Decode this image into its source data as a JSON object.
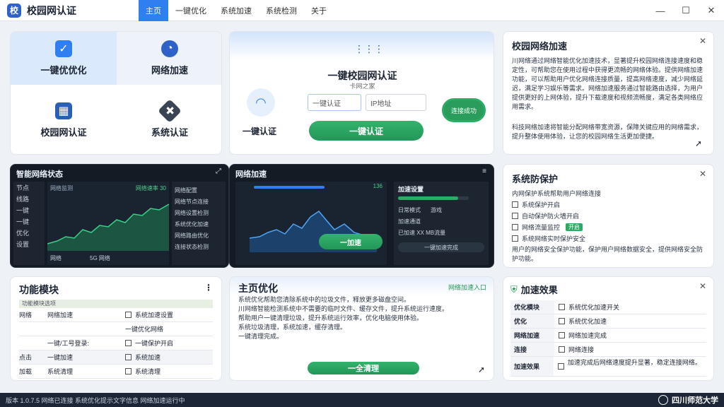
{
  "app": {
    "title": "校园网认证",
    "logo": "校"
  },
  "tabs": [
    "主页",
    "一键优化",
    "系统加速",
    "系统检测",
    "关于"
  ],
  "window": {
    "min": "—",
    "max": "☐",
    "close": "✕"
  },
  "quick": {
    "optimize": "一键优优化",
    "speed": "网络加速",
    "campus": "校园网认证",
    "sys_auth": "系统认证"
  },
  "auth": {
    "title": "一键校园网认证",
    "subtitle": "卡网之家",
    "wifi_label": "一键认证",
    "account_placeholder": "一键认证",
    "ip_placeholder": "IP地址",
    "button": "一键认证",
    "badge": "连接成功"
  },
  "accel_card": {
    "title": "校园网络加速",
    "text": "川网络通过网络智能优化加速技术，显著提升校园网络连接速度和稳定性，可帮助您在使用过程中获得更流畅的网络体验。提供网络加速功能，可以帮助用户优化网络连接质量，提高网络速度，减少网络延迟，满足学习娱乐等需求。网络加速服务通过智能路由选择，为用户提供更好的上网体验，提升下载速度和视频流畅度，满足各类网络应用需求。",
    "text2": "科技网络加速将智能分配网络带宽资源，保障关键应用的网络需求，提升整体使用体验，让您的校园网络生活更加便捷。"
  },
  "smart": {
    "title": "智能网络状态",
    "side": [
      "节点",
      "线路",
      "一键",
      "一键",
      "优化",
      "设置"
    ],
    "legend": "网络监测",
    "metric": "网络速率 30",
    "footer_left": "网络",
    "footer_mid": "5G 网络",
    "list": [
      "网络配置",
      "网络节点连接",
      "网络设置检测",
      "系统优化加速",
      "网络路由优化",
      "连接状态检测"
    ]
  },
  "speed": {
    "title": "网络加速",
    "speed_value": "136",
    "panel_title": "加速设置",
    "opt1": "日常模式",
    "opt1b": "游戏",
    "opt2": "加速通道",
    "opt3": "已加速 XX MB流量",
    "footer": "一键加速完成",
    "button": "一加速"
  },
  "protect": {
    "title": "系统防保护",
    "intro": "内网保护系统帮助用户网络连接",
    "items": [
      "系统保护开启",
      "自动保护防火墙开启",
      "网络流量监控",
      "系统网络实时保护安全"
    ],
    "badge": "开启",
    "note": "用户的网络安全保护功能，保护用户网络数据安全，提供网络安全防护功能。"
  },
  "module": {
    "title": "功能模块",
    "header": "功能模块选项",
    "rows": [
      {
        "k": "网络",
        "v": "网络加速",
        "opt": "系统加速设置"
      },
      {
        "k": "",
        "v": "",
        "opt": "一键优化网络"
      },
      {
        "k": "",
        "v": "一键/工号登录:",
        "opt": "一键保护开启"
      },
      {
        "k": "点击",
        "v": "一键加速",
        "opt": "系统加速"
      },
      {
        "k": "加载",
        "v": "系统清理",
        "opt": "系统清理"
      }
    ]
  },
  "clean": {
    "title": "主页优化",
    "tag": "网络加速入口",
    "lines": [
      "系统优化帮助您清除系统中的垃圾文件，释放更多磁盘空间。",
      "川网络智能检测系统中不需要的临时文件、缓存文件，提升系统运行速度。",
      "帮助用户一键清理垃圾，提升系统运行效率，优化电脑使用体验。",
      "系统垃圾清理，系统加速，缓存清理。",
      "一键清理完成。"
    ],
    "button": "一全清理"
  },
  "effect": {
    "title": "加速效果",
    "rows": [
      {
        "k": "优化模块",
        "v": "系统优化加速开关"
      },
      {
        "k": "优化",
        "v": "系统优化加速"
      },
      {
        "k": "网络加速",
        "v": "网络加速完成"
      },
      {
        "k": "连接",
        "v": "网络连接"
      },
      {
        "k": "加速效果",
        "v": "加速完成后网络速度提升显著，稳定连接网络。"
      }
    ]
  },
  "status": {
    "text": "版本 1.0.7.5  网络已连接  系统优化提示文字信息  网络加速运行中",
    "brand": "四川师范大学"
  },
  "colors": {
    "accent": "#2f7ff0",
    "green": "#229657",
    "dark": "#141b24"
  }
}
